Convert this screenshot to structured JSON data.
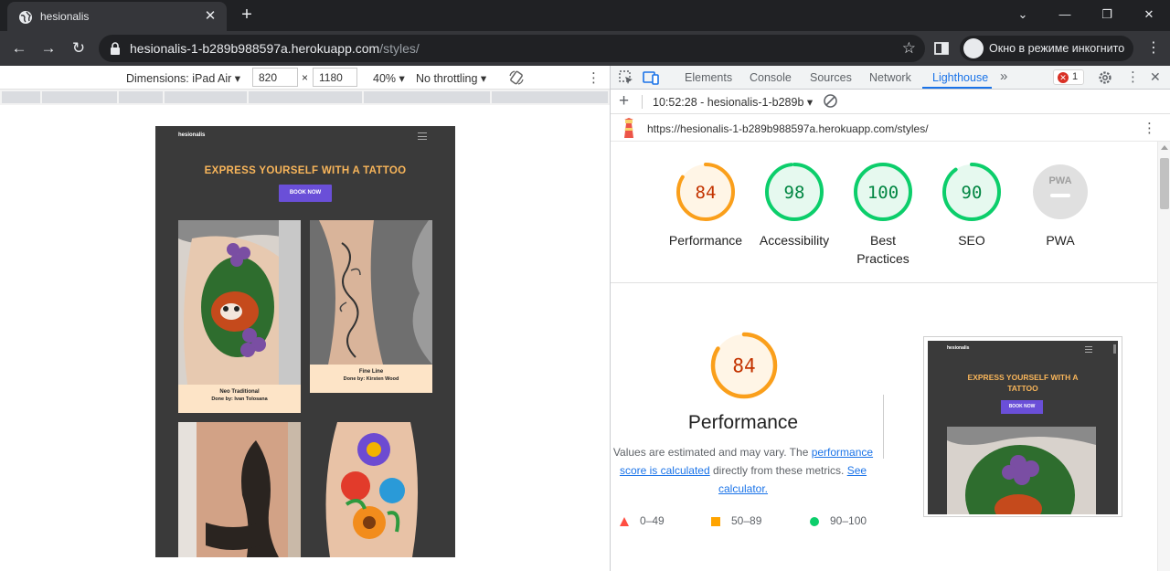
{
  "browser": {
    "tab_title": "hesionalis",
    "url_host": "hesionalis-1-b289b988597a.herokuapp.com",
    "url_path": "/styles/",
    "incognito_label": "Окно в режиме инкогнито"
  },
  "device_toolbar": {
    "dimensions_label": "Dimensions: iPad Air",
    "width": "820",
    "height": "1180",
    "times": "×",
    "zoom": "40%",
    "throttling": "No throttling"
  },
  "site": {
    "logo": "hesionalis",
    "hero_title": "EXPRESS YOURSELF WITH A TATTOO",
    "book_label": "BOOK NOW",
    "cards": [
      {
        "style": "Neo Traditional",
        "artist": "Done by: Ivan Tolosana"
      },
      {
        "style": "Fine Line",
        "artist": "Done by: Kirsten Wood"
      }
    ]
  },
  "devtools": {
    "tabs": [
      "Elements",
      "Console",
      "Sources",
      "Network",
      "Lighthouse"
    ],
    "active_tab": "Lighthouse",
    "more_tabs": "»",
    "error_count": "1",
    "report_label": "10:52:28 - hesionalis-1-b289b",
    "report_url": "https://hesionalis-1-b289b988597a.herokuapp.com/styles/"
  },
  "lighthouse": {
    "scores": [
      {
        "label": "Performance",
        "value": "84",
        "score": 84,
        "color": "#fa9f1b",
        "bg": "#fff5e6",
        "text": "#c33300"
      },
      {
        "label": "Accessibility",
        "value": "98",
        "score": 98,
        "color": "#0cce6b",
        "bg": "#e6f9ef",
        "text": "#018642"
      },
      {
        "label": "Best Practices",
        "value": "100",
        "score": 100,
        "color": "#0cce6b",
        "bg": "#e6f9ef",
        "text": "#018642"
      },
      {
        "label": "SEO",
        "value": "90",
        "score": 90,
        "color": "#0cce6b",
        "bg": "#e6f9ef",
        "text": "#018642"
      },
      {
        "label": "PWA",
        "value": "PWA",
        "score": 0,
        "color": "#d9d9d9",
        "bg": "#e0e0e0",
        "text": "#9e9e9e"
      }
    ],
    "performance": {
      "score": "84",
      "title": "Performance",
      "desc_before": "Values are estimated and may vary. The ",
      "desc_link": "performance score is calculated",
      "desc_middle": " directly from these metrics. ",
      "desc_link2": "See calculator."
    },
    "legend": [
      {
        "range": "0–49",
        "color": "#ff4e42"
      },
      {
        "range": "50–89",
        "color": "#ffa400"
      },
      {
        "range": "90–100",
        "color": "#0cce6b"
      }
    ],
    "screenshot": {
      "logo": "hesionalis",
      "title": "EXPRESS YOURSELF WITH A TATTOO",
      "book": "BOOK NOW"
    }
  }
}
